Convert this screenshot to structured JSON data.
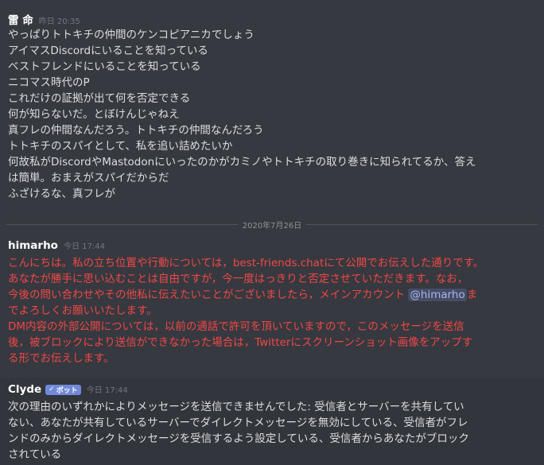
{
  "messages": {
    "m1": {
      "author": "雷 命",
      "timestamp": "昨日 20:35",
      "lines": [
        "やっぱりトトキチの仲間のケンコピアニカでしょう",
        "アイマスDiscordにいることを知っている",
        "ベストフレンドにいることを知っている",
        "ニコマス時代のP",
        "これだけの証拠が出て何を否定できる",
        "何が知らないだ。とぼけんじゃねえ",
        "真フレの仲間なんだろう。トトキチの仲間なんだろう",
        "トトキチのスパイとして、私を追い詰めたいか",
        "何故私がDiscordやMastodonにいったのかがカミノやトトキチの取り巻きに知られてるか、答え",
        "は簡単。おまえがスパイだからだ",
        "ふざけるな、真フレが"
      ]
    },
    "divider_date": "2020年7月26日",
    "m2": {
      "author": "himarho",
      "timestamp": "今日 17:44",
      "lines": [
        "こんにちは。私の立ち位置や行動については，best-friends.chatにて公開でお伝えした通りです。",
        "あなたが勝手に思い込むことは自由ですが，今一度はっきりと否定させていただきます。なお，",
        "今後の問い合わせやその他私に伝えたいことがございましたら，メインアカウント ",
        "でよろしくお願いいたします。",
        "DM内容の外部公開については，以前の通話で許可を頂いていますので，このメッセージを送信",
        "後，被ブロックにより送信ができなかった場合は，Twitterにスクリーンショット画像をアップす",
        "る形でお伝えします。"
      ],
      "mention": "@himarho",
      "mention_after": "ま"
    },
    "m3": {
      "author": "Clyde",
      "bot_label": "ボット",
      "timestamp": "今日 17:44",
      "lines": [
        "次の理由のいずれかによりメッセージを送信できませんでした: 受信者とサーバーを共有してい",
        "ない、あなたが共有しているサーバーでダイレクトメッセージを無効にしている、受信者がフレ",
        "ンドのみからダイレクトメッセージを受信するよう設定している、受信者からあなたがブロック",
        "されている"
      ]
    }
  }
}
